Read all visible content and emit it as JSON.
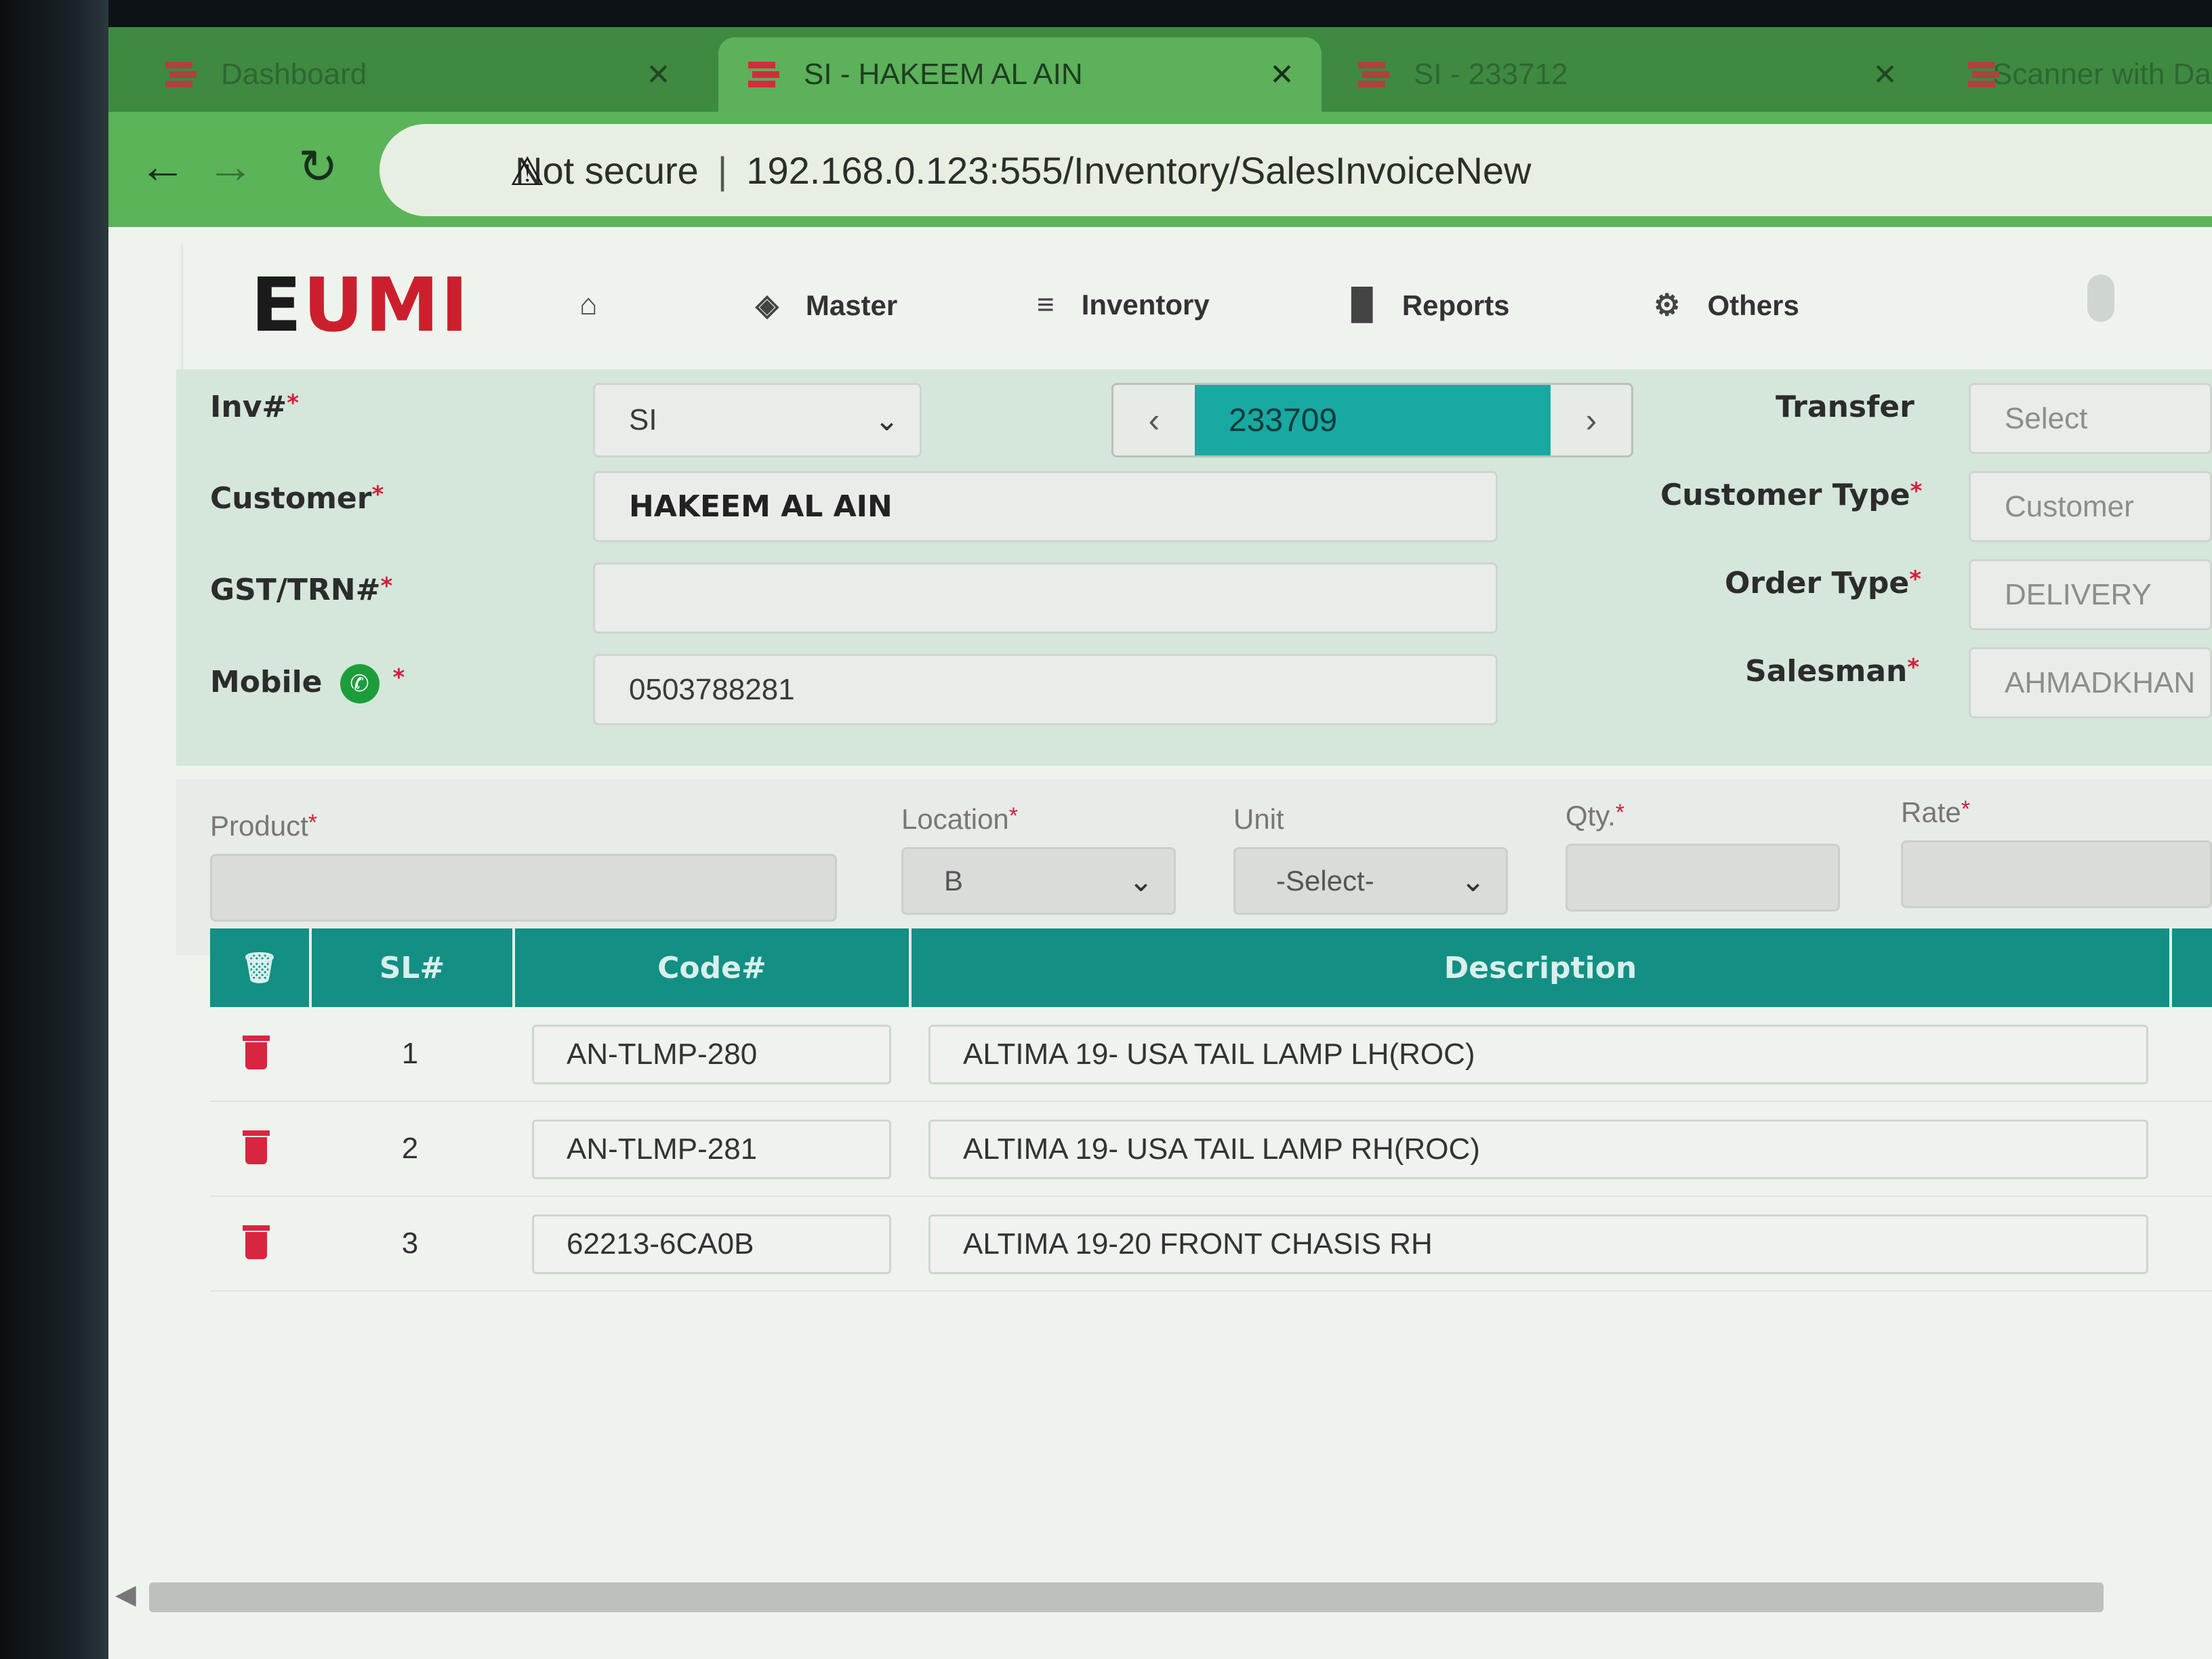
{
  "browser": {
    "tabs": [
      {
        "title": "Dashboard",
        "active": false
      },
      {
        "title": "SI - HAKEEM AL AIN",
        "active": true
      },
      {
        "title": "SI - 233712",
        "active": false
      },
      {
        "title": "Scanner with Dashb",
        "active": false
      }
    ],
    "close_glyph": "✕",
    "security_label": "Not secure",
    "url": "192.168.0.123:555/Inventory/SalesInvoiceNew"
  },
  "app": {
    "logo": {
      "first": "E",
      "rest": "UMI"
    },
    "menu": [
      {
        "icon": "home-icon",
        "label": ""
      },
      {
        "icon": "cube-icon",
        "label": "Master"
      },
      {
        "icon": "layers-icon",
        "label": "Inventory"
      },
      {
        "icon": "bar-chart-icon",
        "label": "Reports"
      },
      {
        "icon": "gear-icon",
        "label": "Others"
      }
    ]
  },
  "form": {
    "inv_label": "Inv#",
    "inv_prefix": "SI",
    "inv_number": "233709",
    "transfer_label": "Transfer",
    "transfer_value": "Select",
    "customer_label": "Customer",
    "customer_value": "HAKEEM AL AIN",
    "customer_type_label": "Customer Type",
    "customer_type_value": "Customer",
    "gst_label": "GST/TRN#",
    "gst_value": "",
    "order_type_label": "Order Type",
    "order_type_value": "DELIVERY",
    "mobile_label": "Mobile",
    "mobile_value": "0503788281",
    "salesman_label": "Salesman",
    "salesman_value": "AHMADKHAN"
  },
  "entry": {
    "product_label": "Product",
    "location_label": "Location",
    "location_value": "B",
    "unit_label": "Unit",
    "unit_value": "-Select-",
    "qty_label": "Qty.",
    "rate_label": "Rate"
  },
  "table": {
    "headers": {
      "sl": "SL#",
      "code": "Code#",
      "description": "Description"
    },
    "rows": [
      {
        "sl": "1",
        "code": "AN-TLMP-280",
        "description": "ALTIMA 19- USA TAIL LAMP LH(ROC)"
      },
      {
        "sl": "2",
        "code": "AN-TLMP-281",
        "description": "ALTIMA 19- USA TAIL LAMP RH(ROC)"
      },
      {
        "sl": "3",
        "code": "62213-6CA0B",
        "description": "ALTIMA 19-20 FRONT CHASIS RH"
      }
    ]
  },
  "colors": {
    "accent": "#138f83",
    "brand_red": "#cc1f2d",
    "chrome_green": "#5bb458"
  }
}
